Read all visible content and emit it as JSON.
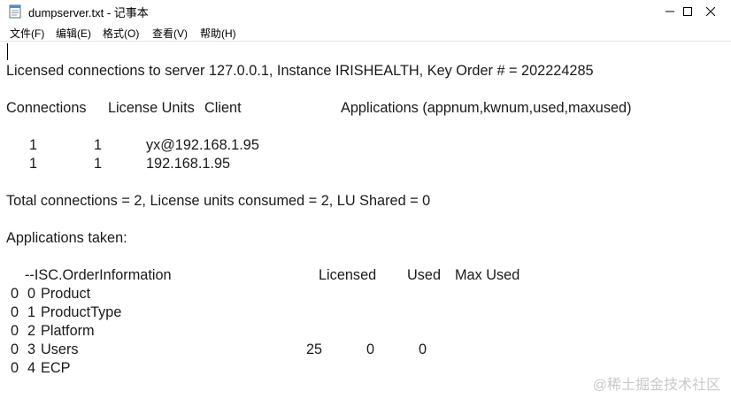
{
  "window": {
    "title": "dumpserver.txt - 记事本",
    "icon": "notepad-icon",
    "controls": [
      "minimize-icon",
      "maximize-icon",
      "close-icon"
    ]
  },
  "menu": [
    "文件(F)",
    "编辑(E)",
    "格式(O)",
    "查看(V)",
    "帮助(H)"
  ],
  "content": {
    "license_line": "Licensed connections to server 127.0.0.1, Instance IRISHEALTH, Key Order # = 202224285",
    "conn_headers": {
      "connections": "Connections",
      "license_units": "License Units",
      "client": "Client",
      "applications": "Applications (appnum,kwnum,used,maxused)"
    },
    "conn_rows": [
      {
        "connections": "1",
        "units": "1",
        "client": "yx@192.168.1.95"
      },
      {
        "connections": "1",
        "units": "1",
        "client": "192.168.1.95"
      }
    ],
    "total_line": "Total connections = 2, License units consumed = 2, LU Shared = 0",
    "apps_title": "Applications taken:",
    "app_headers": {
      "name": "--ISC.OrderInformation",
      "licensed": "Licensed",
      "used": "Used",
      "max_used": "Max Used"
    },
    "app_rows": [
      {
        "a": "0",
        "b": "0",
        "name": "Product",
        "licensed": "",
        "used": "",
        "max_used": ""
      },
      {
        "a": "0",
        "b": "1",
        "name": "ProductType",
        "licensed": "",
        "used": "",
        "max_used": ""
      },
      {
        "a": "0",
        "b": "2",
        "name": "Platform",
        "licensed": "",
        "used": "",
        "max_used": ""
      },
      {
        "a": "0",
        "b": "3",
        "name": "Users",
        "licensed": "25",
        "used": "0",
        "max_used": "0"
      },
      {
        "a": "0",
        "b": "4",
        "name": "ECP",
        "licensed": "",
        "used": "",
        "max_used": ""
      }
    ]
  },
  "watermark": "@稀土掘金技术社区"
}
